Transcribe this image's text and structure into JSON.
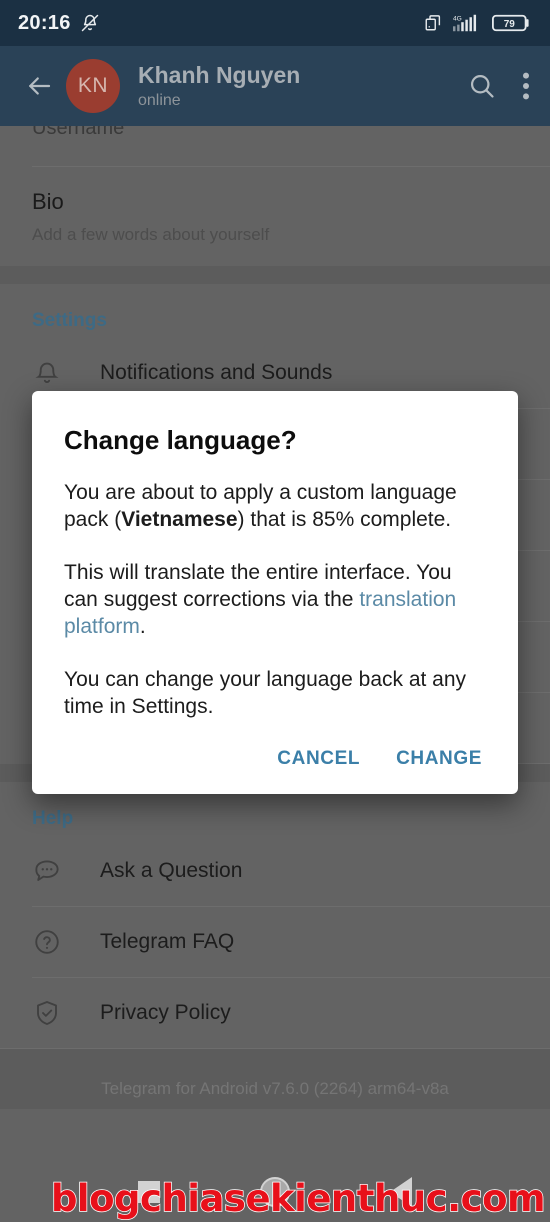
{
  "status_bar": {
    "time": "20:16",
    "mute_icon": "bell-muted-icon",
    "screenshot_icon": "copy-icon",
    "network_label": "4G",
    "signal_icon": "signal-bars-icon",
    "battery_level": "79"
  },
  "toolbar": {
    "back_icon": "arrow-left-icon",
    "avatar_initials": "KN",
    "title": "Khanh Nguyen",
    "subtitle": "online",
    "search_icon": "search-icon",
    "overflow_icon": "more-vertical-icon"
  },
  "settings_page": {
    "username_label": "Username",
    "bio_title": "Bio",
    "bio_placeholder": "Add a few words about yourself",
    "settings_section": {
      "header": "Settings",
      "items": [
        {
          "label": "Notifications and Sounds",
          "icon": "bell-icon"
        }
      ]
    },
    "help_section": {
      "header": "Help",
      "items": [
        {
          "label": "Ask a Question",
          "icon": "chat-bubble-icon"
        },
        {
          "label": "Telegram FAQ",
          "icon": "question-circle-icon"
        },
        {
          "label": "Privacy Policy",
          "icon": "shield-check-icon"
        }
      ]
    },
    "version": "Telegram for Android v7.6.0 (2264) arm64-v8a"
  },
  "dialog": {
    "title": "Change language?",
    "paragraph1_before": "You are about to apply a custom language pack (",
    "paragraph1_bold": "Vietnamese",
    "paragraph1_after": ") that is 85% complete.",
    "paragraph2_before": "This will translate the entire interface. You can suggest corrections via the ",
    "paragraph2_link": "translation platform",
    "paragraph2_after": ".",
    "paragraph3": "You can change your language back at any time in Settings.",
    "cancel_label": "CANCEL",
    "confirm_label": "CHANGE",
    "accent_color": "#3b7fa8",
    "link_color": "#5b8aa6"
  },
  "nav_bar": {
    "recents_icon": "square-icon",
    "home_icon": "circle-icon",
    "back_icon": "triangle-back-icon"
  },
  "watermark": {
    "text": "blogchiasekienthuc.com",
    "color": "#e8101a"
  }
}
